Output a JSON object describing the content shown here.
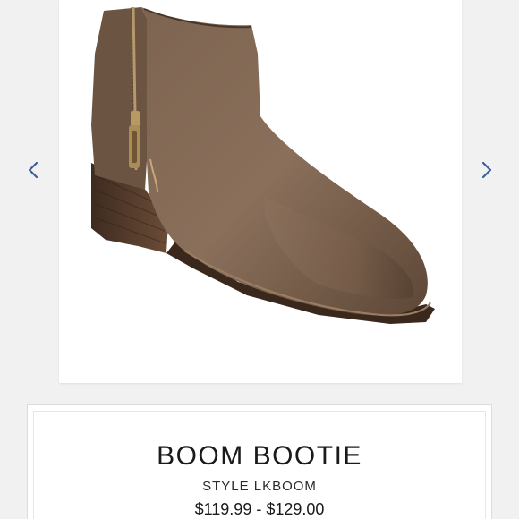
{
  "carousel": {
    "prev_icon": "chevron-left-icon",
    "next_icon": "chevron-right-icon",
    "arrow_color": "#3d5f95"
  },
  "product": {
    "image_alt": "Brown leather ankle bootie with side zipper",
    "name": "BOOM BOOTIE",
    "style": "STYLE LKBOOM",
    "price": "$119.99 - $129.00"
  }
}
